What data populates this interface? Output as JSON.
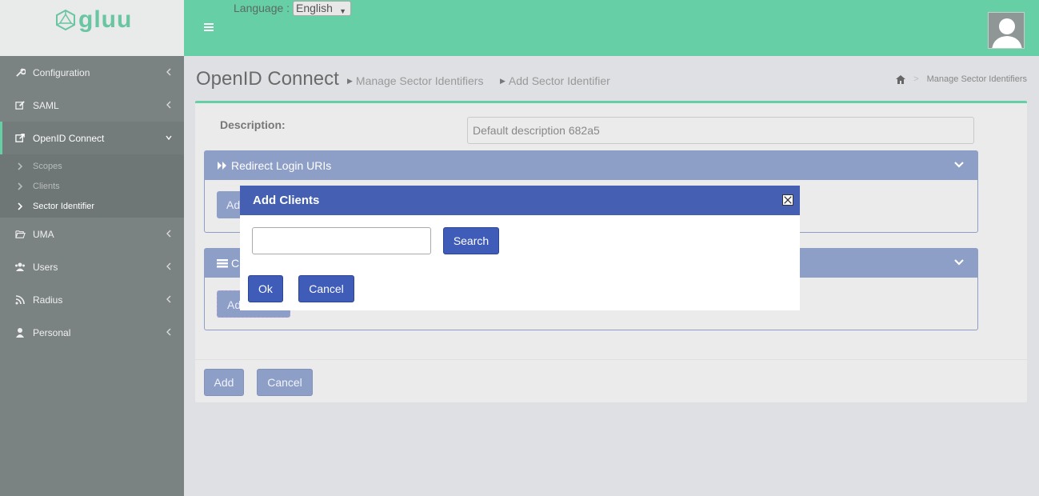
{
  "app": {
    "logo_text": "gluu"
  },
  "header": {
    "language_label": "Language :",
    "language_value": "English"
  },
  "sidebar": {
    "items": [
      {
        "label": "Configuration",
        "icon": "wrench-icon"
      },
      {
        "label": "SAML",
        "icon": "edit-icon"
      },
      {
        "label": "OpenID Connect",
        "icon": "external-link-icon"
      },
      {
        "label": "UMA",
        "icon": "folder-open-icon"
      },
      {
        "label": "Users",
        "icon": "users-icon"
      },
      {
        "label": "Radius",
        "icon": "rss-icon"
      },
      {
        "label": "Personal",
        "icon": "user-icon"
      }
    ],
    "sub_items": [
      {
        "label": "Scopes"
      },
      {
        "label": "Clients"
      },
      {
        "label": "Sector Identifier"
      }
    ]
  },
  "page": {
    "title": "OpenID Connect",
    "crumb1": "Manage Sector Identifiers",
    "crumb2": "Add Sector Identifier",
    "crumb_right": "Manage Sector Identifiers"
  },
  "form": {
    "description_label": "Description:",
    "description_value": "Default description 682a5",
    "redirect_panel_title": "Redirect Login URIs",
    "redirect_add_partial": "Ad",
    "clients_panel_title_partial": "C",
    "clients_add_partial": "Ad",
    "add_label": "Add",
    "cancel_label": "Cancel"
  },
  "modal": {
    "title": "Add Clients",
    "search_value": "",
    "search_label": "Search",
    "ok_label": "Ok",
    "cancel_label": "Cancel"
  },
  "colors": {
    "header_green": "#66cfa6",
    "sidebar": "#7b8282",
    "panel_blue": "#8d9ec7",
    "modal_blue": "#4560b3"
  }
}
